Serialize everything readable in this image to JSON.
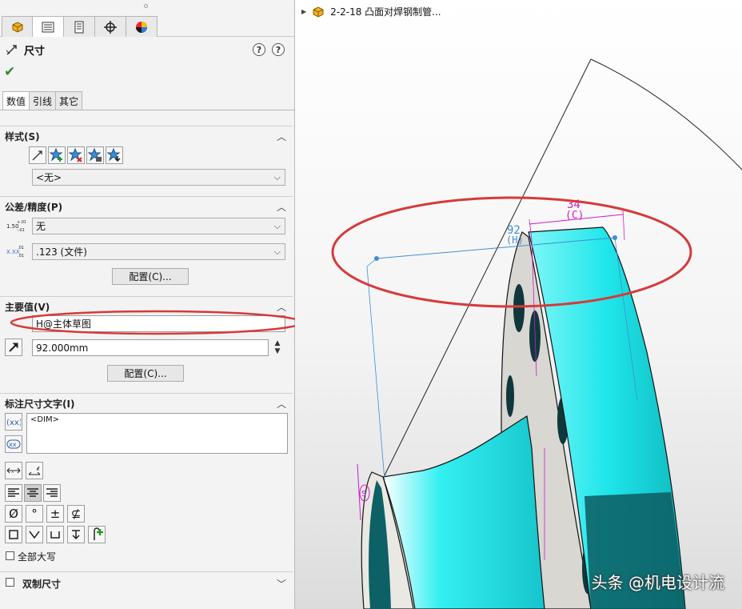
{
  "tabs": [
    {
      "icon": "feature-manager-icon"
    },
    {
      "icon": "property-manager-icon"
    },
    {
      "icon": "configuration-manager-icon"
    },
    {
      "icon": "dimxpert-icon"
    },
    {
      "icon": "display-manager-icon"
    }
  ],
  "property": {
    "title": "尺寸",
    "help1": "?",
    "help2": "?"
  },
  "subtabs": [
    "数值",
    "引线",
    "其它"
  ],
  "style": {
    "title": "样式(S)",
    "combo": "<无>"
  },
  "tolerance": {
    "title": "公差/精度(P)",
    "tol_type": "无",
    "precision": ".123 (文件)",
    "config_button": "配置(C)...",
    "tol_icon_text": "1.50 +.01 -.01",
    "prec_icon_text": "X.XXX .01"
  },
  "primary": {
    "title": "主要值(V)",
    "name": "H@主体草图",
    "value": "92.000mm",
    "config_button": "配置(C)..."
  },
  "dimtext": {
    "title": "标注尺寸文字(I)",
    "content": "<DIM>",
    "symbols": [
      "Ø",
      "°",
      "±",
      "⊈"
    ]
  },
  "allcaps": "全部大写",
  "dual": "双制尺寸",
  "tree": {
    "item": "2-2-18 凸面对焊钢制管..."
  },
  "dims": {
    "d1": "34",
    "d1_sub": "(C)",
    "d2": "92",
    "d2_sub": "(H)",
    "d3": "S"
  },
  "watermark": "头条 @机电设计流",
  "colors": {
    "accent_red": "#d63a3a",
    "part_cyan": "#1fe6ea",
    "dim_magenta": "#d019c8",
    "dim_blue": "#3f8fd0"
  }
}
